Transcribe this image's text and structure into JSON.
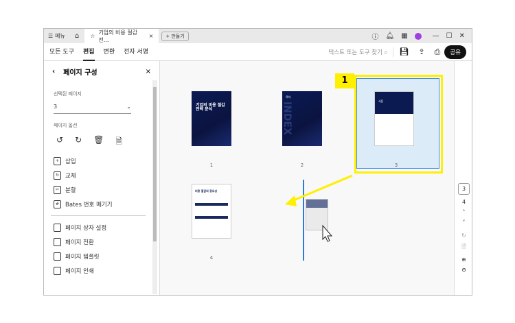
{
  "titlebar": {
    "menu": "메뉴",
    "tab_title": "기업의 비용 절감 전...",
    "new_tab": "만들기"
  },
  "toolbar": {
    "tabs": [
      "모든 도구",
      "편집",
      "변환",
      "전자 서명"
    ],
    "search_placeholder": "텍스트 또는 도구 찾기",
    "share": "공유"
  },
  "panel": {
    "title": "페이지 구성",
    "selected_label": "선택된 페이지",
    "selected_value": "3",
    "options_label": "페이지 옵션",
    "items": [
      "삽입",
      "교체",
      "분할",
      "Bates 번호 매기기"
    ],
    "items2": [
      "페이지 상자 설정",
      "페이지 전환",
      "페이지 템플릿",
      "페이지 인쇄"
    ]
  },
  "pages": {
    "p1_title": "기업의 비용 절감 전략 분석",
    "p2_title": "목차",
    "p2_watermark": "INDEX",
    "p3_title": "서론",
    "p4_title": "비용 절감의 중요성",
    "labels": [
      "1",
      "2",
      "3",
      "4"
    ]
  },
  "annotation": {
    "step": "1"
  },
  "rail": {
    "current_page": "3",
    "next_page": "4"
  }
}
